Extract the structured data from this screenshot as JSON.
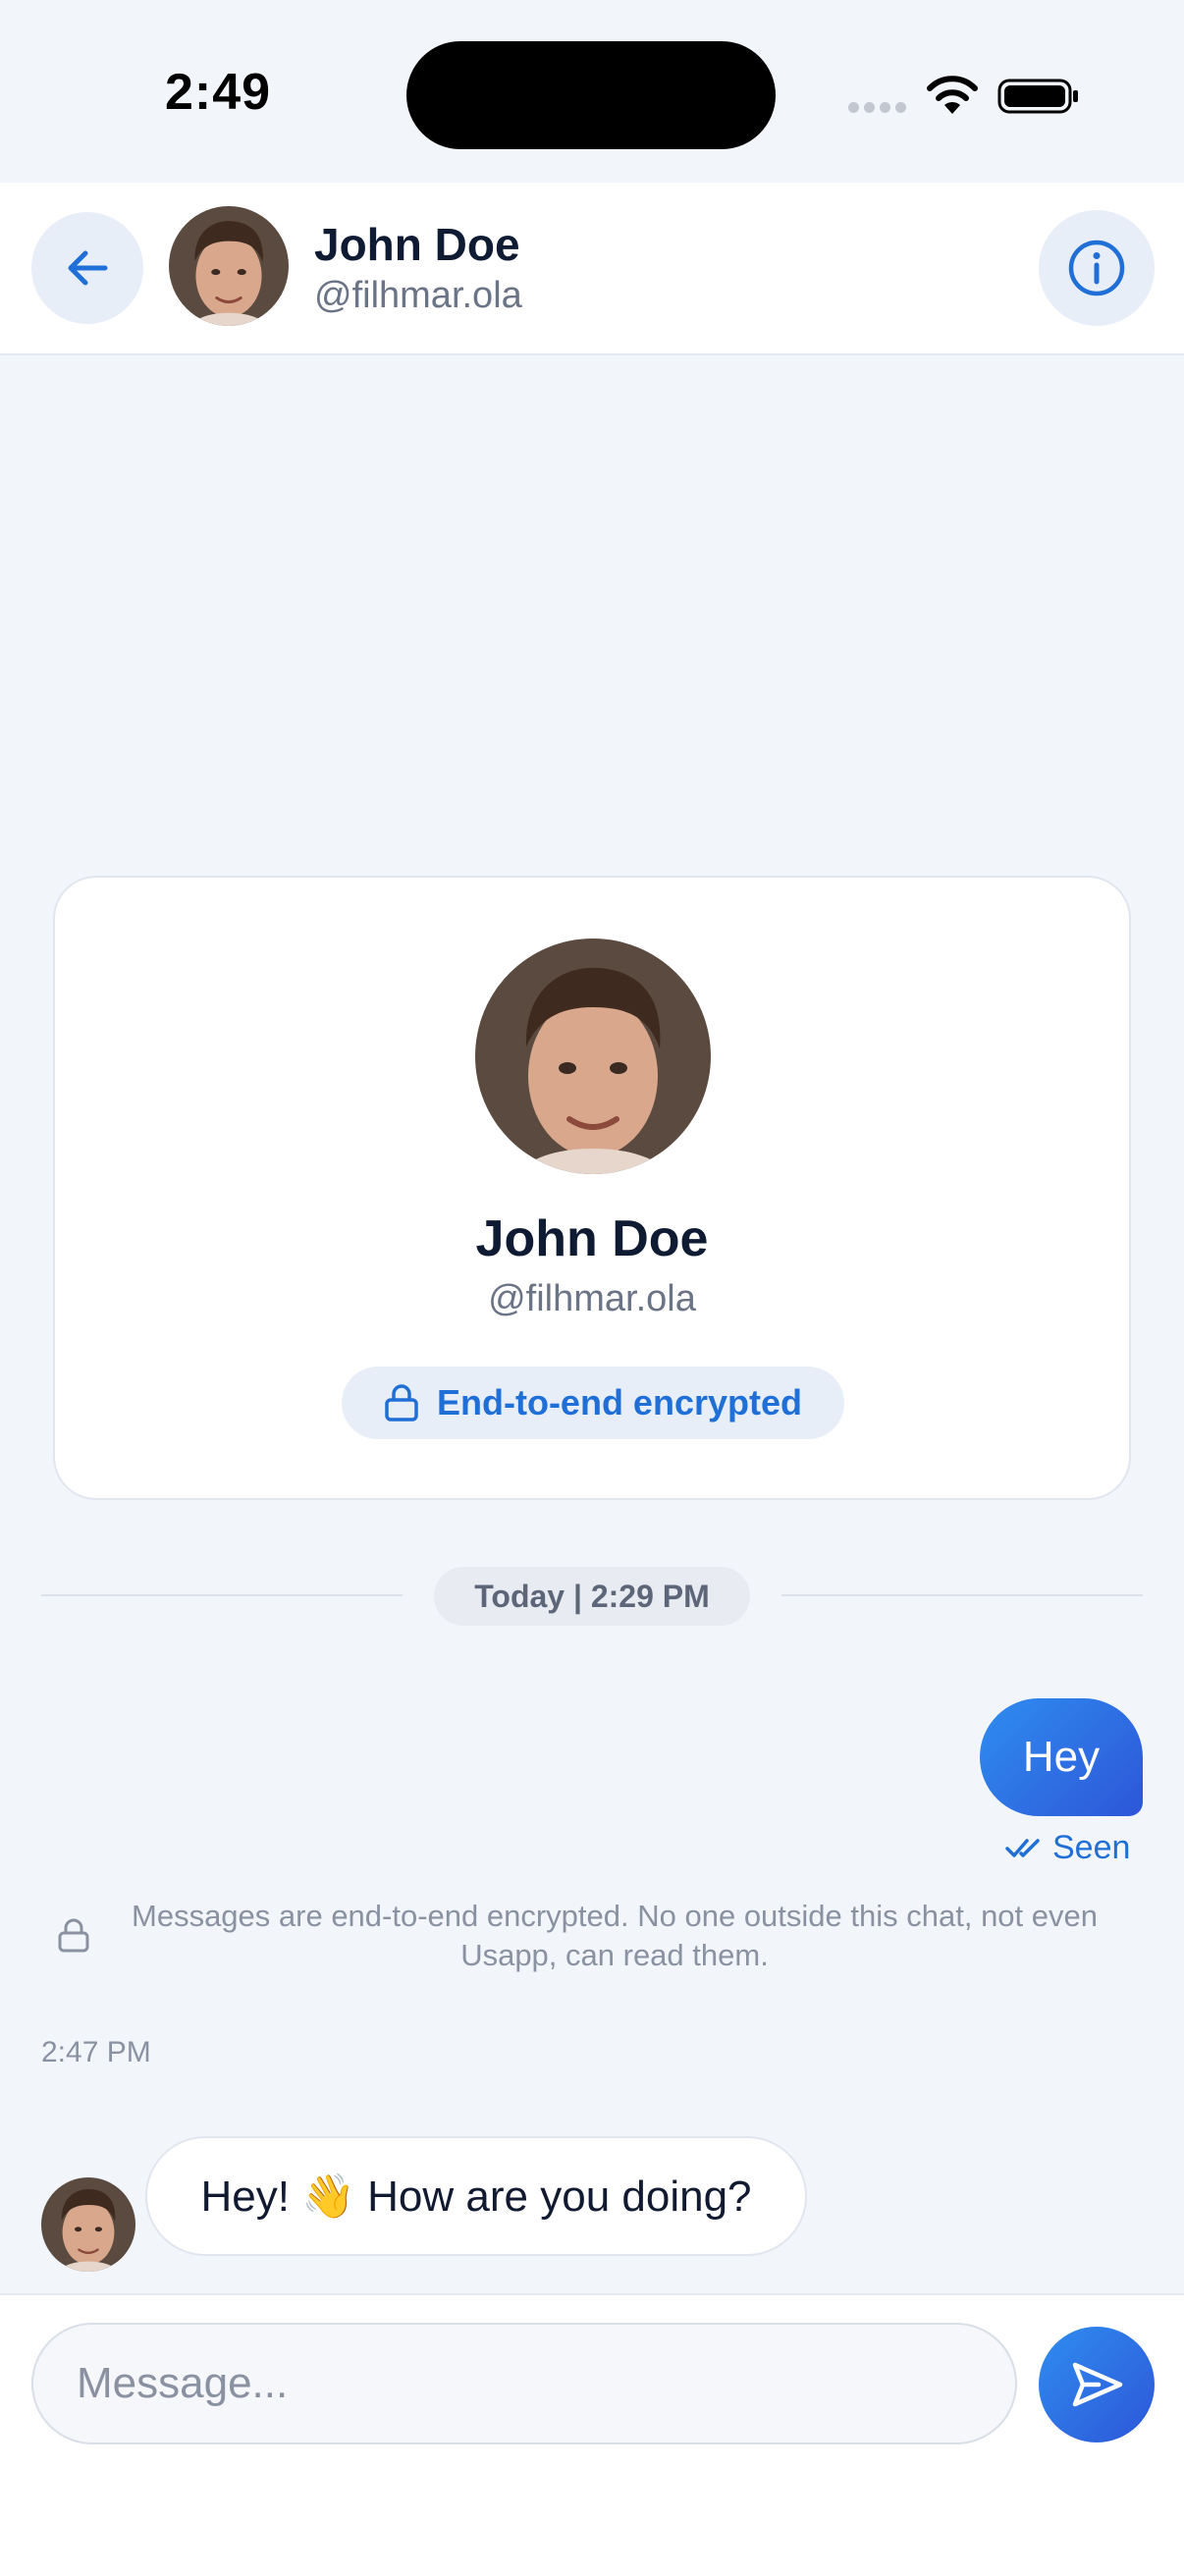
{
  "status_bar": {
    "time": "2:49"
  },
  "header": {
    "name": "John Doe",
    "handle": "@filhmar.ola",
    "back_icon": "arrow-left-icon",
    "info_icon": "info-circle-icon"
  },
  "profile_card": {
    "name": "John Doe",
    "handle": "@filhmar.ola",
    "badge_label": "End-to-end encrypted",
    "badge_icon": "lock-icon"
  },
  "conversation": {
    "date_divider": "Today | 2:29 PM",
    "outgoing": {
      "text": "Hey",
      "status": "Seen",
      "status_icon": "double-check-icon"
    },
    "encryption_notice": "Messages are end-to-end encrypted. No one outside this chat, not even Usapp, can read them.",
    "time_label": "2:47 PM",
    "incoming": {
      "text": "Hey! 👋 How are you doing?"
    }
  },
  "composer": {
    "placeholder": "Message...",
    "send_icon": "send-icon"
  },
  "colors": {
    "accent": "#1f6fd6",
    "background": "#f2f5fa",
    "bubble_gradient_start": "#2f8df0",
    "bubble_gradient_end": "#2d56d8"
  }
}
